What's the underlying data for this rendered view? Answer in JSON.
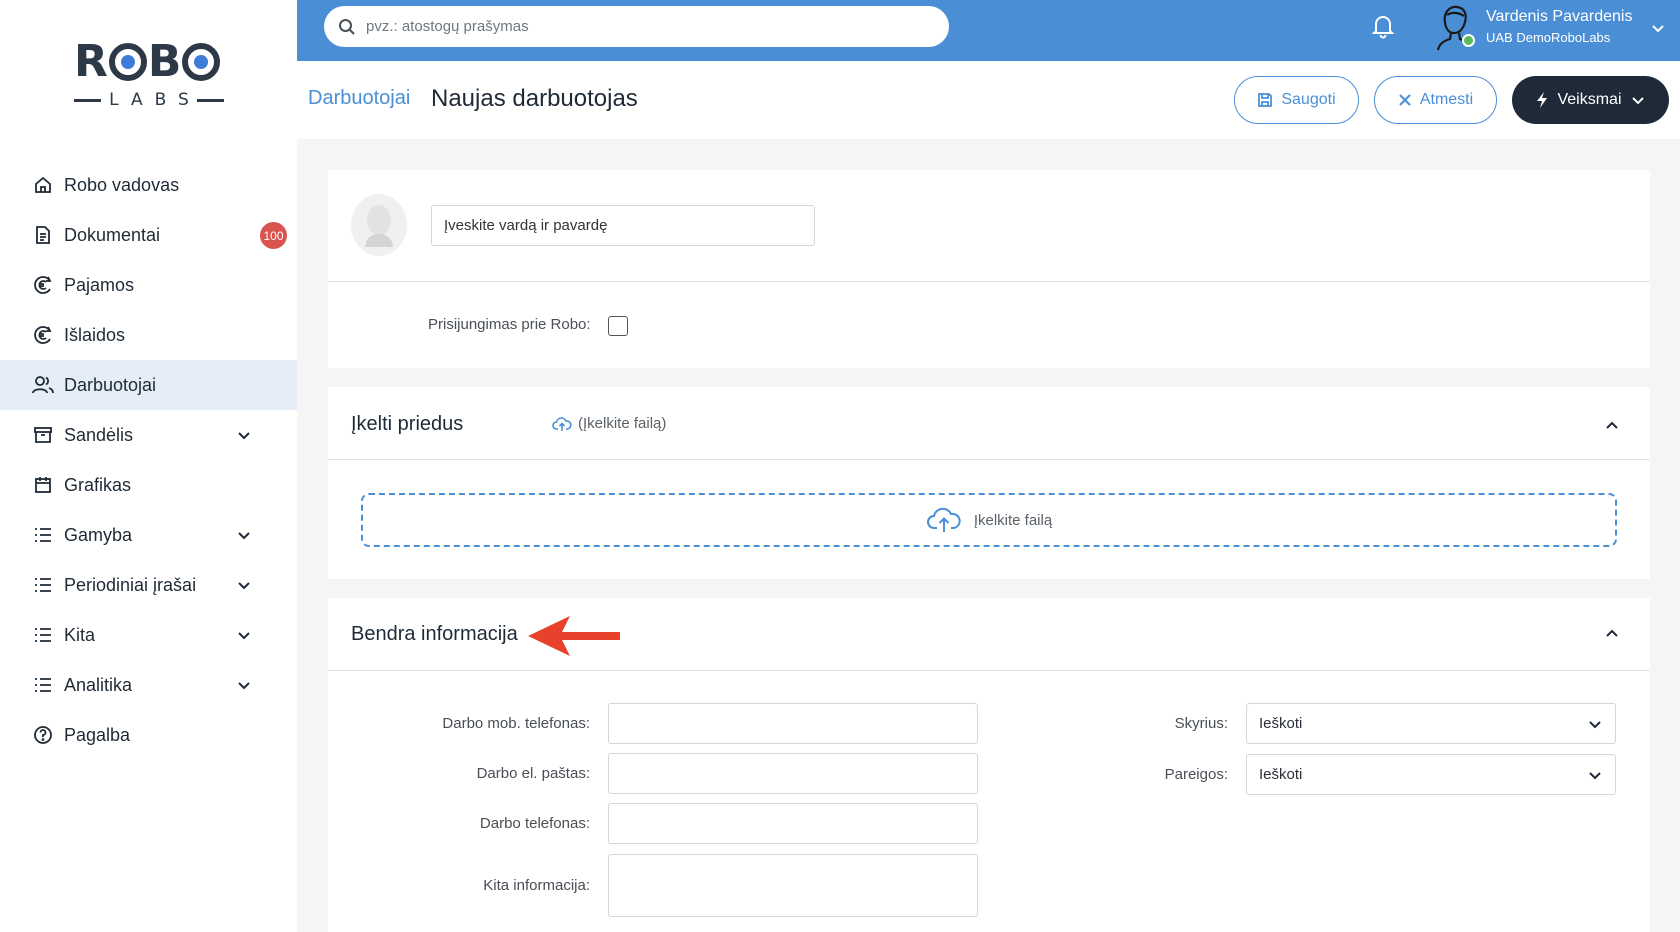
{
  "logo": {
    "top": "ROBO",
    "bottom": "LABS"
  },
  "sidebar": {
    "items": [
      {
        "label": "Robo vadovas",
        "icon": "home-icon",
        "active": false,
        "expandable": false
      },
      {
        "label": "Dokumentai",
        "icon": "document-icon",
        "active": false,
        "expandable": false,
        "badge": "100"
      },
      {
        "label": "Pajamos",
        "icon": "euro-icon",
        "active": false,
        "expandable": false
      },
      {
        "label": "Išlaidos",
        "icon": "euro-icon",
        "active": false,
        "expandable": false
      },
      {
        "label": "Darbuotojai",
        "icon": "users-icon",
        "active": true,
        "expandable": false
      },
      {
        "label": "Sandėlis",
        "icon": "archive-icon",
        "active": false,
        "expandable": true
      },
      {
        "label": "Grafikas",
        "icon": "calendar-icon",
        "active": false,
        "expandable": false
      },
      {
        "label": "Gamyba",
        "icon": "list-icon",
        "active": false,
        "expandable": true
      },
      {
        "label": "Periodiniai įrašai",
        "icon": "list-icon",
        "active": false,
        "expandable": true
      },
      {
        "label": "Kita",
        "icon": "list-icon",
        "active": false,
        "expandable": true
      },
      {
        "label": "Analitika",
        "icon": "list-icon",
        "active": false,
        "expandable": true
      },
      {
        "label": "Pagalba",
        "icon": "help-icon",
        "active": false,
        "expandable": false
      }
    ]
  },
  "topbar": {
    "search_placeholder": "pvz.: atostogų prašymas",
    "user_name": "Vardenis Pavardenis",
    "company": "UAB DemoRoboLabs"
  },
  "header": {
    "breadcrumb": "Darbuotojai",
    "title": "Naujas darbuotojas",
    "save_label": "Saugoti",
    "cancel_label": "Atmesti",
    "actions_label": "Veiksmai"
  },
  "employee": {
    "name_placeholder": "Įveskite vardą ir pavardę",
    "login_label": "Prisijungimas prie Robo:"
  },
  "attachments": {
    "title": "Įkelti priedus",
    "upload_link": "(Įkelkite failą)",
    "dropzone_text": "Įkelkite failą"
  },
  "general": {
    "title": "Bendra informacija",
    "fields_left": [
      {
        "label": "Darbo mob. telefonas:"
      },
      {
        "label": "Darbo el. paštas:"
      },
      {
        "label": "Darbo telefonas:"
      },
      {
        "label": "Kita informacija:"
      }
    ],
    "fields_right": [
      {
        "label": "Skyrius:",
        "value": "Ieškoti"
      },
      {
        "label": "Pareigos:",
        "value": "Ieškoti"
      }
    ]
  },
  "colors": {
    "accent": "#4a8fd6",
    "dark": "#1e2a38",
    "badge": "#d9534f",
    "arrow": "#e8412c"
  }
}
